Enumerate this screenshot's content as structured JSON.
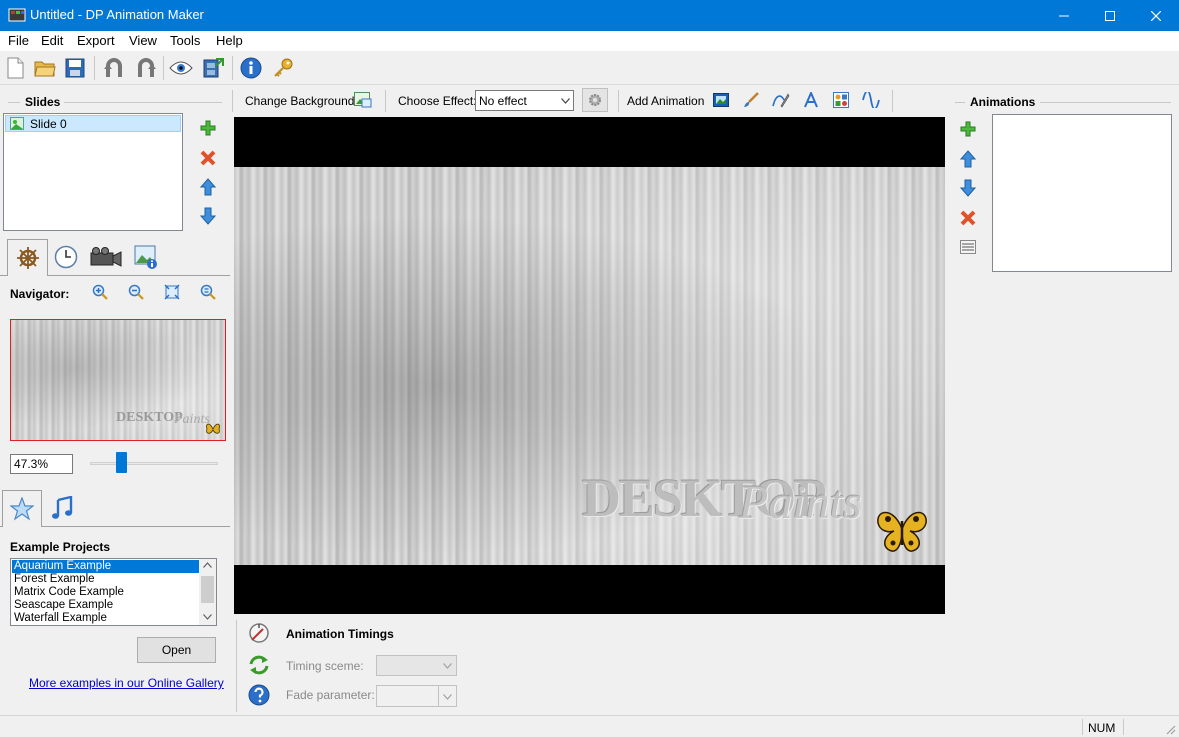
{
  "window": {
    "title": "Untitled - DP Animation Maker"
  },
  "menu": [
    "File",
    "Edit",
    "Export",
    "View",
    "Tools",
    "Help"
  ],
  "slides": {
    "header": "Slides",
    "items": [
      "Slide 0"
    ]
  },
  "center_toolbar": {
    "change_background": "Change Background",
    "choose_effect_label": "Choose Effect:",
    "effect_value": "No effect",
    "add_animation": "Add Animation"
  },
  "navigator": {
    "label": "Navigator:",
    "zoom": "47.3%",
    "slider_fraction": 0.22
  },
  "preview": {
    "logo_text_1": "DESKTOP",
    "logo_text_2": "Paints"
  },
  "projects": {
    "header": "Example Projects",
    "items": [
      "Aquarium Example",
      "Forest Example",
      "Matrix Code Example",
      "Seascape Example",
      "Waterfall Example"
    ],
    "selected": "Aquarium Example",
    "open_label": "Open",
    "gallery_link": "More examples in our Online Gallery"
  },
  "animations": {
    "header": "Animations"
  },
  "timings": {
    "header": "Animation Timings",
    "timing_scene_label": "Timing sceme:",
    "fade_param_label": "Fade parameter:"
  },
  "status": {
    "num": "NUM"
  },
  "colors": {
    "accent": "#0078d7",
    "selection": "#3399ff",
    "link": "#0000cc",
    "preview_frame": "#e02020"
  }
}
